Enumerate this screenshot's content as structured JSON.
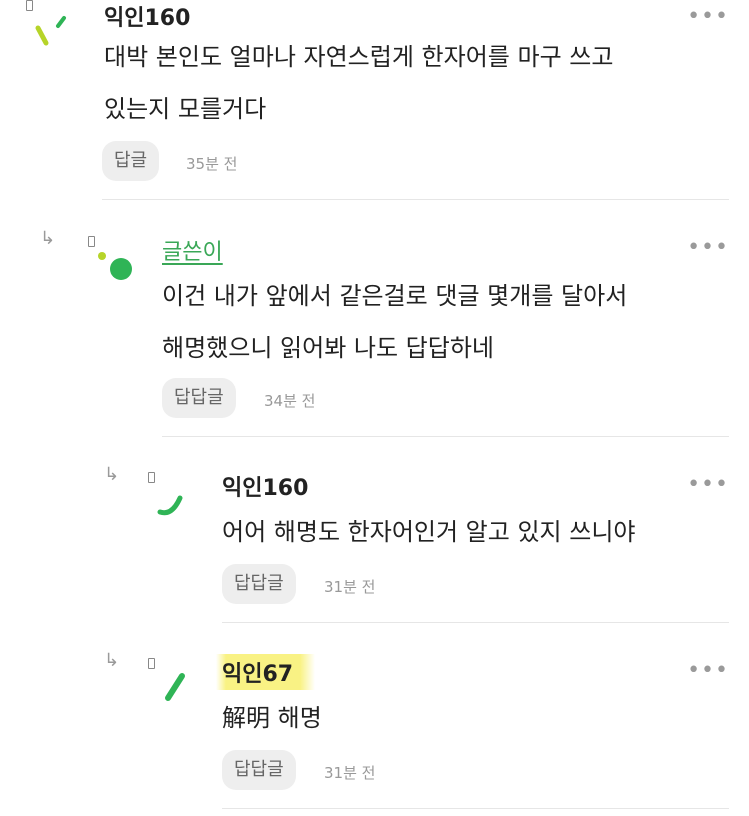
{
  "comments": [
    {
      "nickname": "익인160",
      "lines": [
        "대박 본인도 얼마나 자연스럽게 한자어를 마구 쓰고",
        "있는지 모를거다"
      ],
      "reply_label": "답글",
      "time": "35분 전",
      "more": "•••"
    },
    {
      "nickname": "글쓴이",
      "lines": [
        "이건 내가 앞에서 같은걸로 댓글 몇개를 달아서",
        "해명했으니 읽어봐 나도 답답하네"
      ],
      "reply_label": "답답글",
      "time": "34분 전",
      "more": "•••",
      "reply_arrow": "↳"
    },
    {
      "nickname": "익인160",
      "lines": [
        "어어 해명도 한자어인거 알고 있지 쓰니야"
      ],
      "reply_label": "답답글",
      "time": "31분 전",
      "more": "•••",
      "reply_arrow": "↳"
    },
    {
      "nickname": "익인67",
      "lines": [
        "解明 해명"
      ],
      "reply_label": "답답글",
      "time": "31분 전",
      "more": "•••",
      "reply_arrow": "↳"
    }
  ],
  "colors": {
    "author": "#3aa757",
    "highlight": "#f8f06e",
    "avatar_green": "#2fb456",
    "avatar_lime": "#b6d429"
  }
}
